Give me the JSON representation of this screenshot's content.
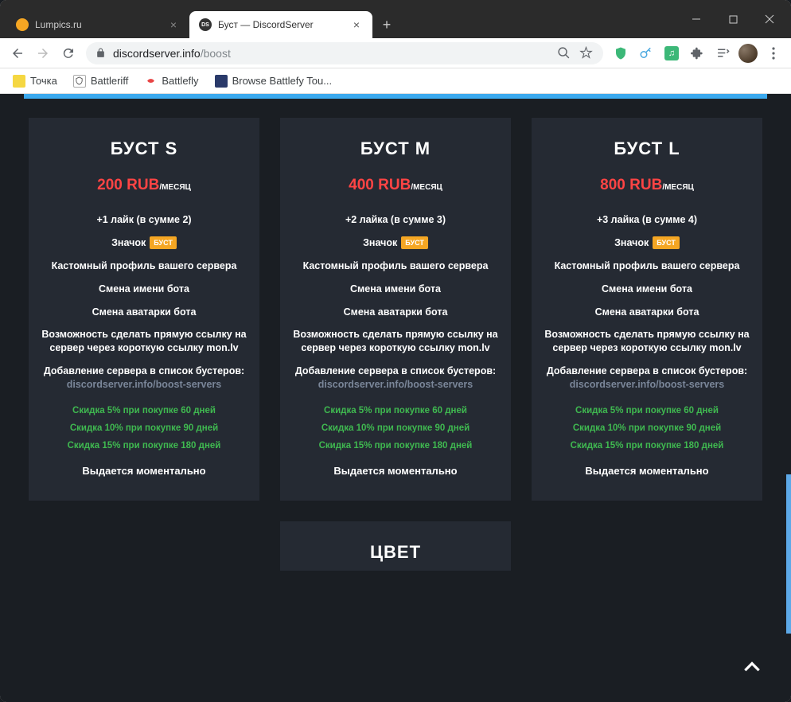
{
  "window": {
    "tabs": [
      {
        "title": "Lumpics.ru",
        "favicon_color": "#f5a623",
        "active": false
      },
      {
        "title": "Буст — DiscordServer",
        "favicon_color": "#333",
        "favicon_text": "DS",
        "active": true
      }
    ]
  },
  "address": {
    "domain": "discordserver.info",
    "path": "/boost"
  },
  "bookmarks": [
    {
      "label": "Точка",
      "color": "#f5d742"
    },
    {
      "label": "Battleriff",
      "color": "#ddd"
    },
    {
      "label": "Battlefly",
      "color": "#e84545"
    },
    {
      "label": "Browse Battlefy Tou...",
      "color": "#3a4a8a"
    }
  ],
  "plans": [
    {
      "title": "БУСТ S",
      "price": "200 RUB",
      "period": "/МЕСЯЦ",
      "likes": "+1 лайк (в сумме 2)",
      "badge_label": "Значок",
      "badge_text": "БУСТ",
      "custom_profile": "Кастомный профиль вашего сервера",
      "bot_name": "Смена имени бота",
      "bot_avatar": "Смена аватарки бота",
      "shortlink": "Возможность сделать прямую ссылку на сервер через короткую ссылку mon.lv",
      "boosters_prefix": "Добавление сервера в список бустеров: ",
      "boosters_link": "discordserver.info/boost-servers",
      "discounts": [
        "Скидка 5% при покупке 60 дней",
        "Скидка 10% при покупке 90 дней",
        "Скидка 15% при покупке 180 дней"
      ],
      "instant": "Выдается моментально"
    },
    {
      "title": "БУСТ M",
      "price": "400 RUB",
      "period": "/МЕСЯЦ",
      "likes": "+2 лайка (в сумме 3)",
      "badge_label": "Значок",
      "badge_text": "БУСТ",
      "custom_profile": "Кастомный профиль вашего сервера",
      "bot_name": "Смена имени бота",
      "bot_avatar": "Смена аватарки бота",
      "shortlink": "Возможность сделать прямую ссылку на сервер через короткую ссылку mon.lv",
      "boosters_prefix": "Добавление сервера в список бустеров: ",
      "boosters_link": "discordserver.info/boost-servers",
      "discounts": [
        "Скидка 5% при покупке 60 дней",
        "Скидка 10% при покупке 90 дней",
        "Скидка 15% при покупке 180 дней"
      ],
      "instant": "Выдается моментально"
    },
    {
      "title": "БУСТ L",
      "price": "800 RUB",
      "period": "/МЕСЯЦ",
      "likes": "+3 лайка (в сумме 4)",
      "badge_label": "Значок",
      "badge_text": "БУСТ",
      "custom_profile": "Кастомный профиль вашего сервера",
      "bot_name": "Смена имени бота",
      "bot_avatar": "Смена аватарки бота",
      "shortlink": "Возможность сделать прямую ссылку на сервер через короткую ссылку mon.lv",
      "boosters_prefix": "Добавление сервера в список бустеров: ",
      "boosters_link": "discordserver.info/boost-servers",
      "discounts": [
        "Скидка 5% при покупке 60 дней",
        "Скидка 10% при покупке 90 дней",
        "Скидка 15% при покупке 180 дней"
      ],
      "instant": "Выдается моментально"
    }
  ],
  "color_section": {
    "title": "ЦВЕТ"
  }
}
